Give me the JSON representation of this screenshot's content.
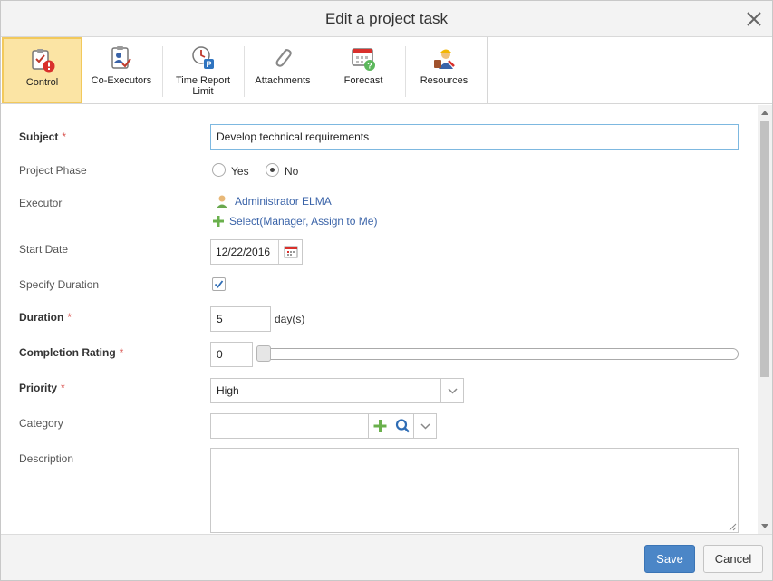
{
  "dialog": {
    "title": "Edit a project task"
  },
  "toolbar": {
    "items": [
      {
        "label": "Control",
        "icon": "task-control-icon",
        "active": true
      },
      {
        "label": "Co-Executors",
        "icon": "co-executors-icon"
      },
      {
        "label": "Time Report Limit",
        "icon": "time-report-limit-icon"
      },
      {
        "label": "Attachments",
        "icon": "paperclip-icon"
      },
      {
        "label": "Forecast",
        "icon": "calendar-forecast-icon"
      },
      {
        "label": "Resources",
        "icon": "resources-worker-icon"
      }
    ]
  },
  "form": {
    "subject": {
      "label": "Subject",
      "required": "*",
      "value": "Develop technical requirements"
    },
    "project_phase": {
      "label": "Project Phase",
      "yes": "Yes",
      "no": "No",
      "selected": "No"
    },
    "executor": {
      "label": "Executor",
      "user": "Administrator ELMA",
      "select": "Select",
      "paren_open": "(",
      "manager": "Manager",
      "comma": ", ",
      "assign_to_me": "Assign to Me",
      "paren_close": ")"
    },
    "start_date": {
      "label": "Start Date",
      "value": "12/22/2016"
    },
    "specify_duration": {
      "label": "Specify Duration",
      "checked": true
    },
    "duration": {
      "label": "Duration",
      "required": "*",
      "value": "5",
      "unit": "day(s)"
    },
    "completion_rating": {
      "label": "Completion Rating",
      "required": "*",
      "value": "0"
    },
    "priority": {
      "label": "Priority",
      "required": "*",
      "value": "High"
    },
    "category": {
      "label": "Category",
      "value": ""
    },
    "description": {
      "label": "Description",
      "value": ""
    }
  },
  "footer": {
    "save": "Save",
    "cancel": "Cancel"
  },
  "colors": {
    "accent": "#4b86c7",
    "active_tab": "#fbe4a4",
    "required": "#d9534f",
    "link": "#3a63a8"
  }
}
